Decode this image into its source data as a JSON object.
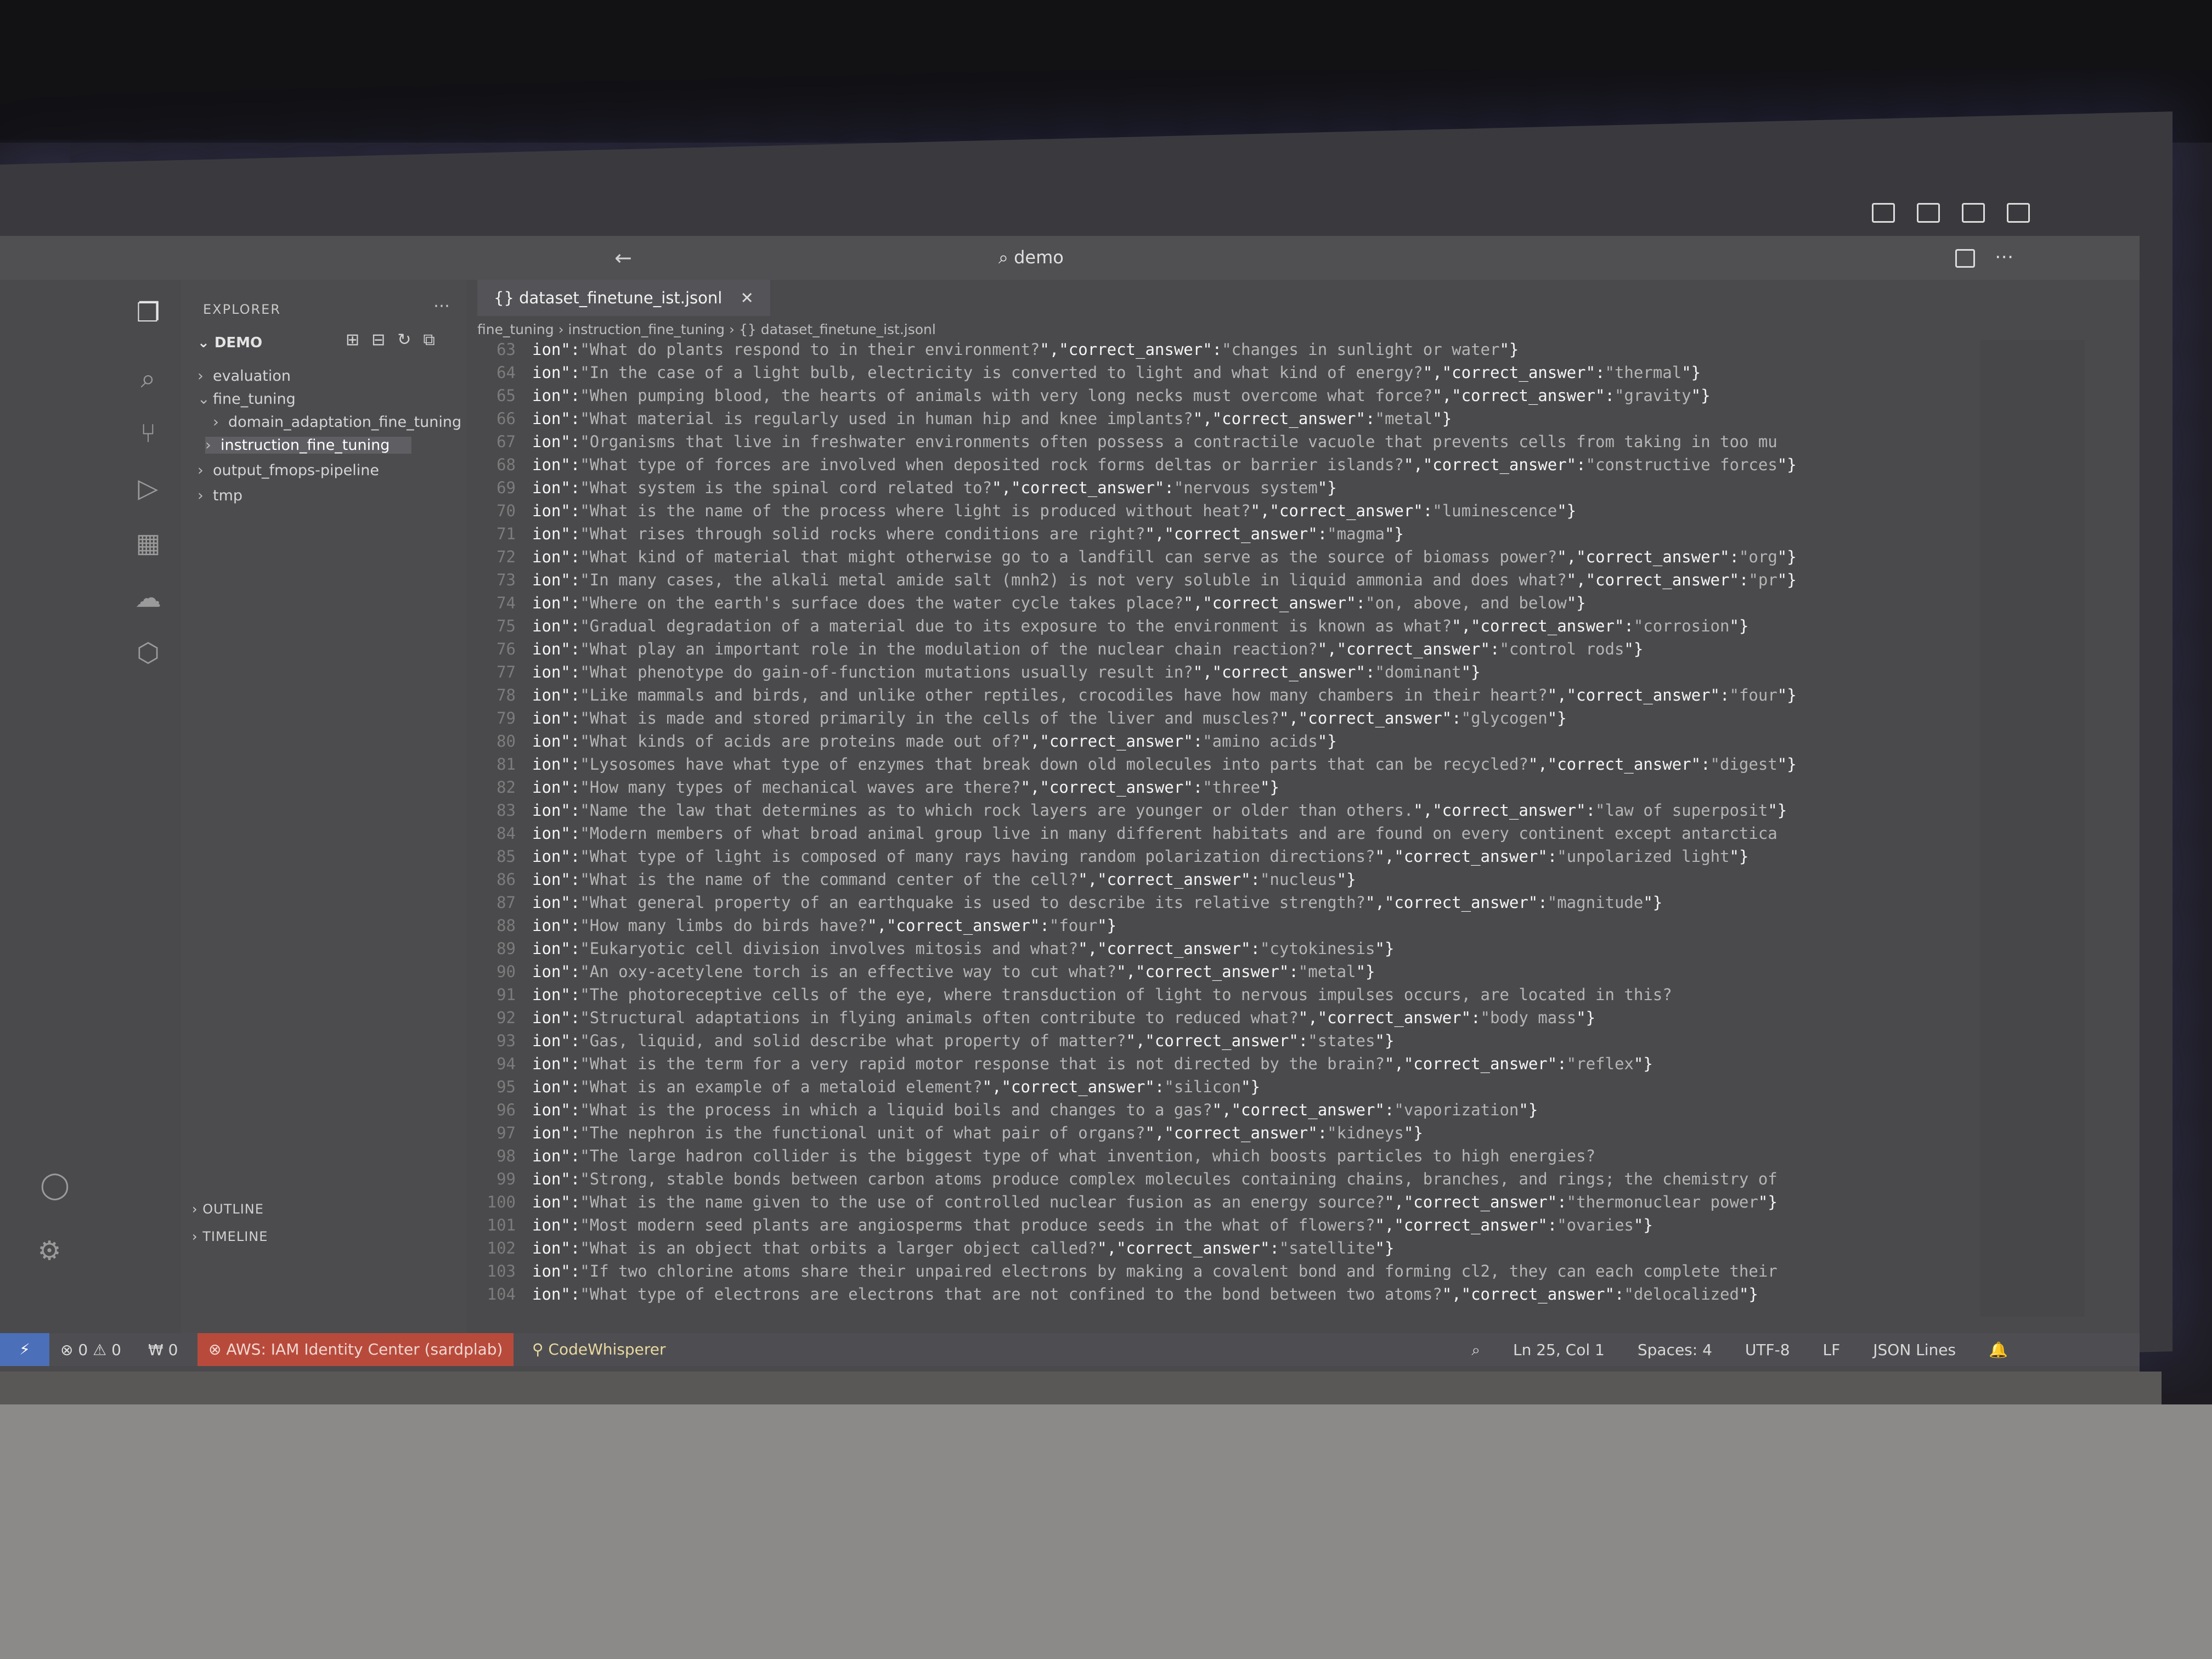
{
  "window": {
    "title": "demo"
  },
  "sidebar": {
    "title": "EXPLORER",
    "root": "DEMO",
    "items": [
      {
        "label": "evaluation"
      },
      {
        "label": "fine_tuning"
      },
      {
        "label": "domain_adaptation_fine_tuning"
      },
      {
        "label": "instruction_fine_tuning"
      },
      {
        "label": "output_fmops-pipeline"
      },
      {
        "label": "tmp"
      }
    ],
    "outline": "OUTLINE",
    "timeline": "TIMELINE"
  },
  "editor": {
    "tab_label": "dataset_finetune_ist.jsonl",
    "breadcrumb": [
      "fine_tuning",
      "instruction_fine_tuning",
      "dataset_finetune_ist.jsonl"
    ],
    "lines": [
      {
        "n": "63",
        "q": "What do plants respond to in their environment?",
        "a": "changes in sunlight or water"
      },
      {
        "n": "64",
        "q": "In the case of a light bulb, electricity is converted to light and what kind of energy?",
        "a": "thermal"
      },
      {
        "n": "65",
        "q": "When pumping blood, the hearts of animals with very long necks must overcome what force?",
        "a": "gravity"
      },
      {
        "n": "66",
        "q": "What material is regularly used in human hip and knee implants?",
        "a": "metal"
      },
      {
        "n": "67",
        "q": "Organisms that live in freshwater environments often possess a contractile vacuole that prevents cells from taking in too mu",
        "a": ""
      },
      {
        "n": "68",
        "q": "What type of forces are involved when deposited rock forms deltas or barrier islands?",
        "a": "constructive forces"
      },
      {
        "n": "69",
        "q": "What system is the spinal cord related to?",
        "a": "nervous system"
      },
      {
        "n": "70",
        "q": "What is the name of the process where light is produced without heat?",
        "a": "luminescence"
      },
      {
        "n": "71",
        "q": "What rises through solid rocks where conditions are right?",
        "a": "magma"
      },
      {
        "n": "72",
        "q": "What kind of material that might otherwise go to a landfill can serve as the source of biomass power?",
        "a": "org"
      },
      {
        "n": "73",
        "q": "In many cases, the alkali metal amide salt (mnh2) is not very soluble in liquid ammonia and does what?",
        "a": "pr"
      },
      {
        "n": "74",
        "q": "Where on the earth's surface does the water cycle takes place?",
        "a": "on, above, and below"
      },
      {
        "n": "75",
        "q": "Gradual degradation of a material due to its exposure to the environment is known as what?",
        "a": "corrosion"
      },
      {
        "n": "76",
        "q": "What play an important role in the modulation of the nuclear chain reaction?",
        "a": "control rods"
      },
      {
        "n": "77",
        "q": "What phenotype do gain-of-function mutations usually result in?",
        "a": "dominant"
      },
      {
        "n": "78",
        "q": "Like mammals and birds, and unlike other reptiles, crocodiles have how many chambers in their heart?",
        "a": "four"
      },
      {
        "n": "79",
        "q": "What is made and stored primarily in the cells of the liver and muscles?",
        "a": "glycogen"
      },
      {
        "n": "80",
        "q": "What kinds of acids are proteins made out of?",
        "a": "amino acids"
      },
      {
        "n": "81",
        "q": "Lysosomes have what type of enzymes that break down old molecules into parts that can be recycled?",
        "a": "digest"
      },
      {
        "n": "82",
        "q": "How many types of mechanical waves are there?",
        "a": "three"
      },
      {
        "n": "83",
        "q": "Name the law that determines as to which rock layers are younger or older than others.",
        "a": "law of superposit"
      },
      {
        "n": "84",
        "q": "Modern members of what broad animal group live in many different habitats and are found on every continent except antarctica",
        "a": ""
      },
      {
        "n": "85",
        "q": "What type of light is composed of many rays having random polarization directions?",
        "a": "unpolarized light"
      },
      {
        "n": "86",
        "q": "What is the name of the command center of the cell?",
        "a": "nucleus"
      },
      {
        "n": "87",
        "q": "What general property of an earthquake is used to describe its relative strength?",
        "a": "magnitude"
      },
      {
        "n": "88",
        "q": "How many limbs do birds have?",
        "a": "four"
      },
      {
        "n": "89",
        "q": "Eukaryotic cell division involves mitosis and what?",
        "a": "cytokinesis"
      },
      {
        "n": "90",
        "q": "An oxy-acetylene torch is an effective way to cut what?",
        "a": "metal"
      },
      {
        "n": "91",
        "q": "The photoreceptive cells of the eye, where transduction of light to nervous impulses occurs, are located in this?",
        "a": ""
      },
      {
        "n": "92",
        "q": "Structural adaptations in flying animals often contribute to reduced what?",
        "a": "body mass"
      },
      {
        "n": "93",
        "q": "Gas, liquid, and solid describe what property of matter?",
        "a": "states"
      },
      {
        "n": "94",
        "q": "What is the term for a  very rapid motor response that is not directed by the brain?",
        "a": "reflex"
      },
      {
        "n": "95",
        "q": "What is an example of a metaloid element?",
        "a": "silicon"
      },
      {
        "n": "96",
        "q": "What is the process in which a liquid boils and changes to a gas?",
        "a": "vaporization"
      },
      {
        "n": "97",
        "q": "The nephron is the functional unit of what pair of organs?",
        "a": "kidneys"
      },
      {
        "n": "98",
        "q": "The large hadron collider is the biggest type of what invention, which boosts particles to high energies?",
        "a": ""
      },
      {
        "n": "99",
        "q": "Strong, stable bonds between carbon atoms produce complex molecules containing chains, branches, and rings; the chemistry of",
        "a": ""
      },
      {
        "n": "100",
        "q": "What is the name given to the use of controlled nuclear fusion as an energy source?",
        "a": "thermonuclear power"
      },
      {
        "n": "101",
        "q": "Most modern seed plants are angiosperms that produce seeds in the what of flowers?",
        "a": "ovaries"
      },
      {
        "n": "102",
        "q": "What is an object that orbits a larger object called?",
        "a": "satellite"
      },
      {
        "n": "103",
        "q": "If two chlorine atoms share their unpaired electrons by making a covalent bond and forming cl2, they can each complete their",
        "a": ""
      },
      {
        "n": "104",
        "q": "What type of electrons are electrons that are not confined to the bond between two atoms?",
        "a": "delocalized"
      }
    ]
  },
  "statusbar": {
    "problems": "⊗ 0 ⚠ 0",
    "ports": "₩ 0",
    "aws": "AWS: IAM Identity Center (sardplab)",
    "codewhisperer": "CodeWhisperer",
    "position": "Ln 25, Col 1",
    "spaces": "Spaces: 4",
    "encoding": "UTF-8",
    "eol": "LF",
    "language": "JSON Lines"
  }
}
